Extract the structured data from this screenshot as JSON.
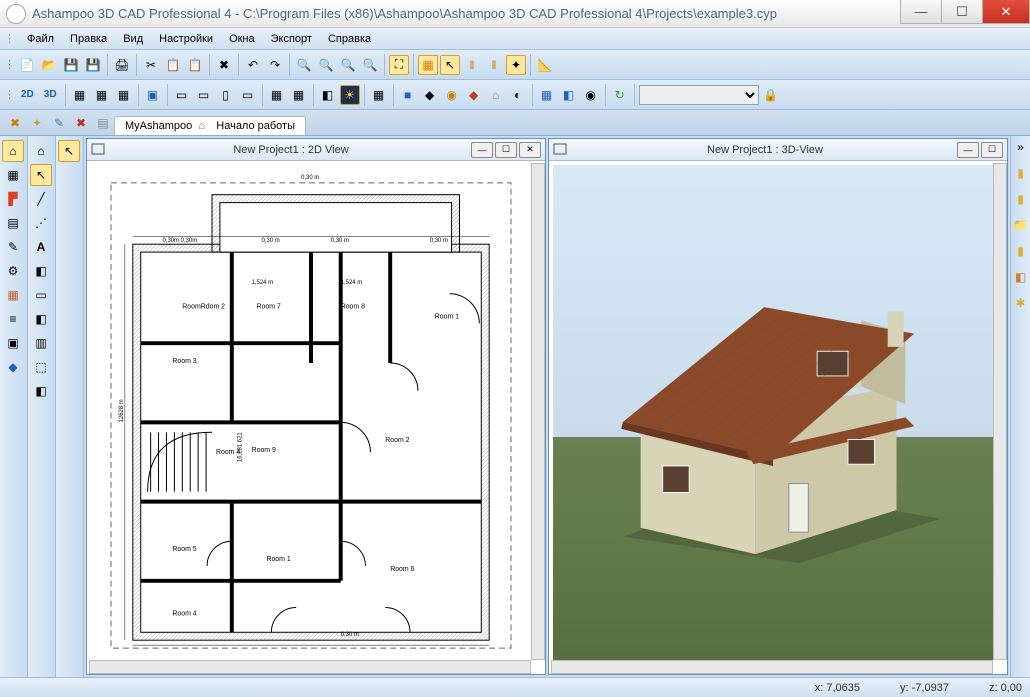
{
  "titlebar": {
    "title": "Ashampoo 3D CAD Professional 4 - C:\\Program Files (x86)\\Ashampoo\\Ashampoo 3D CAD Professional 4\\Projects\\example3.cyp"
  },
  "menu": {
    "items": [
      "Файл",
      "Правка",
      "Вид",
      "Настройки",
      "Окна",
      "Экспорт",
      "Справка"
    ]
  },
  "toolbar2": {
    "mode2d": "2D",
    "mode3d": "3D"
  },
  "tabs": {
    "tab1": "MyAshampoo",
    "tab2": "Начало работы"
  },
  "views": {
    "view2d_title": "New Project1 : 2D View",
    "view3d_title": "New Project1 : 3D-View"
  },
  "rooms": {
    "r1": "Room 1",
    "r2": "Room 2",
    "r2b": "RoomRdom 2",
    "r3": "Room 3",
    "r4": "Room 4",
    "r4b": "Room 4",
    "r5": "Room 5",
    "r6": "Room 6",
    "r7": "Room 7",
    "r8": "Room 8",
    "r9": "Room 9",
    "r1b": "Room 1"
  },
  "dims": {
    "d030": "0,30 m",
    "d1524": "1,524 m",
    "d03b": "0,30 m",
    "d03c": "0,30m 0,30m",
    "d03d": "0,30 m",
    "d1628": "16,281 621",
    "d12628": "12628 m"
  },
  "status": {
    "x_label": "x: ",
    "x_val": "7,0635",
    "y_label": "y: ",
    "y_val": "-7,0937",
    "z_label": "z: ",
    "z_val": "0,00"
  }
}
